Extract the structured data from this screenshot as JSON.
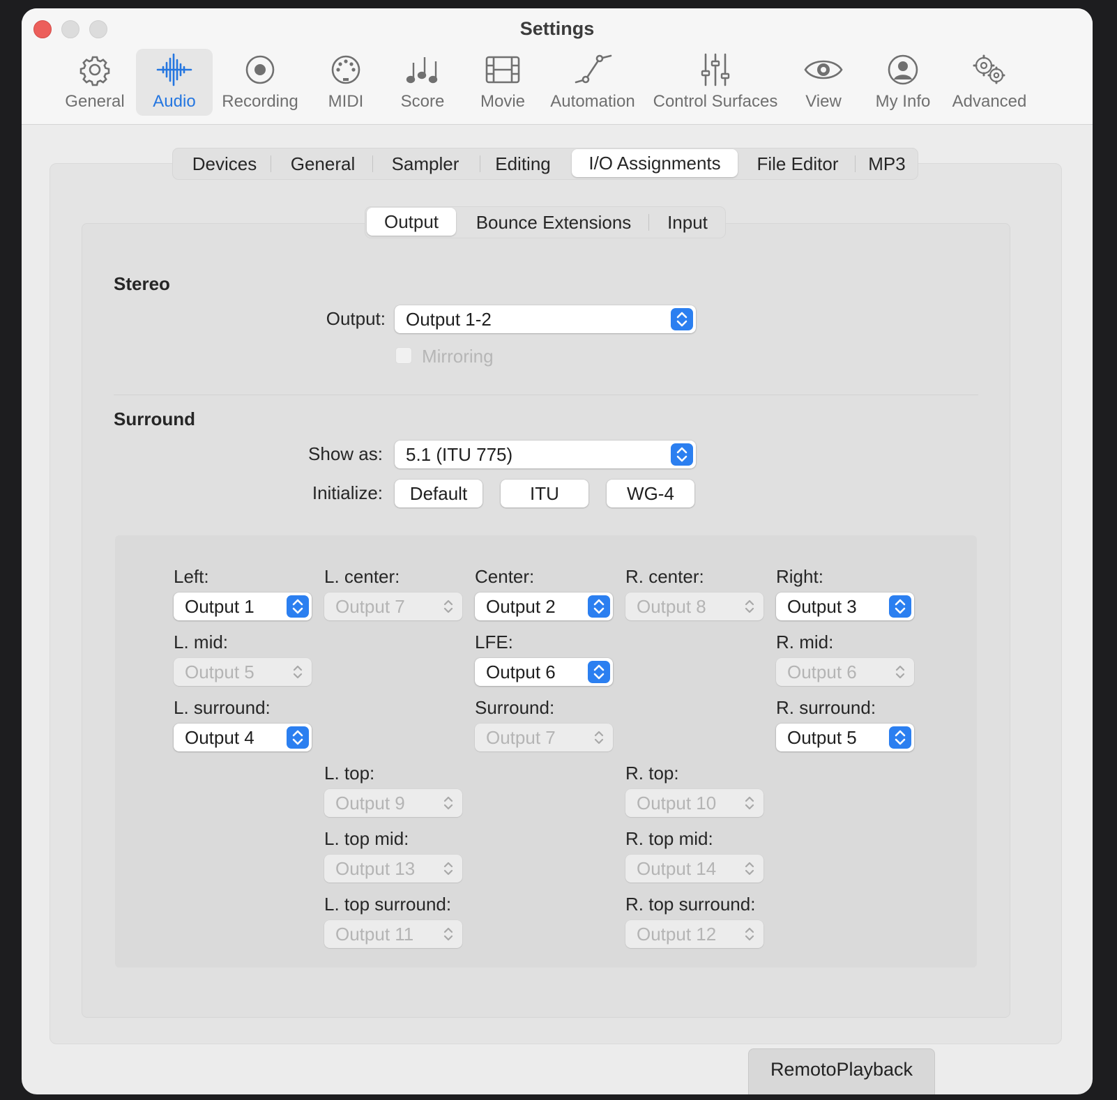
{
  "window": {
    "title": "Settings"
  },
  "toolbar": [
    {
      "label": "General",
      "icon": "gear-icon"
    },
    {
      "label": "Audio",
      "icon": "waveform-icon",
      "selected": true
    },
    {
      "label": "Recording",
      "icon": "record-icon"
    },
    {
      "label": "MIDI",
      "icon": "midi-port-icon"
    },
    {
      "label": "Score",
      "icon": "music-notes-icon"
    },
    {
      "label": "Movie",
      "icon": "film-icon"
    },
    {
      "label": "Automation",
      "icon": "automation-curve-icon"
    },
    {
      "label": "Control Surfaces",
      "icon": "faders-icon"
    },
    {
      "label": "View",
      "icon": "eye-icon"
    },
    {
      "label": "My Info",
      "icon": "person-icon"
    },
    {
      "label": "Advanced",
      "icon": "gears-icon"
    }
  ],
  "audio_tabs": [
    {
      "label": "Devices"
    },
    {
      "label": "General"
    },
    {
      "label": "Sampler"
    },
    {
      "label": "Editing"
    },
    {
      "label": "I/O Assignments",
      "selected": true
    },
    {
      "label": "File Editor"
    },
    {
      "label": "MP3"
    }
  ],
  "io_tabs": [
    {
      "label": "Output",
      "selected": true
    },
    {
      "label": "Bounce Extensions"
    },
    {
      "label": "Input"
    }
  ],
  "stereo": {
    "title": "Stereo",
    "output_label": "Output:",
    "output_value": "Output 1-2",
    "mirroring_label": "Mirroring",
    "mirroring_checked": false
  },
  "surround": {
    "title": "Surround",
    "show_as_label": "Show as:",
    "show_as_value": "5.1 (ITU 775)",
    "initialize_label": "Initialize:",
    "init_buttons": [
      "Default",
      "ITU",
      "WG-4"
    ],
    "channels": {
      "left": {
        "label": "Left:",
        "value": "Output 1",
        "enabled": true
      },
      "l_center": {
        "label": "L. center:",
        "value": "Output 7",
        "enabled": false
      },
      "center": {
        "label": "Center:",
        "value": "Output 2",
        "enabled": true
      },
      "r_center": {
        "label": "R. center:",
        "value": "Output 8",
        "enabled": false
      },
      "right": {
        "label": "Right:",
        "value": "Output 3",
        "enabled": true
      },
      "l_mid": {
        "label": "L. mid:",
        "value": "Output 5",
        "enabled": false
      },
      "lfe": {
        "label": "LFE:",
        "value": "Output 6",
        "enabled": true
      },
      "r_mid": {
        "label": "R. mid:",
        "value": "Output 6",
        "enabled": false
      },
      "l_surround": {
        "label": "L. surround:",
        "value": "Output 4",
        "enabled": true
      },
      "surround": {
        "label": "Surround:",
        "value": "Output 7",
        "enabled": false
      },
      "r_surround": {
        "label": "R. surround:",
        "value": "Output 5",
        "enabled": true
      },
      "l_top": {
        "label": "L. top:",
        "value": "Output 9",
        "enabled": false
      },
      "r_top": {
        "label": "R. top:",
        "value": "Output 10",
        "enabled": false
      },
      "l_top_mid": {
        "label": "L. top mid:",
        "value": "Output 13",
        "enabled": false
      },
      "r_top_mid": {
        "label": "R. top mid:",
        "value": "Output 14",
        "enabled": false
      },
      "l_top_surround": {
        "label": "L. top surround:",
        "value": "Output 11",
        "enabled": false
      },
      "r_top_surround": {
        "label": "R. top surround:",
        "value": "Output 12",
        "enabled": false
      }
    }
  },
  "background_window": {
    "tab_label": "RemotoPlayback"
  },
  "colors": {
    "accent": "#2476e0",
    "close": "#ec5f5b",
    "popup_arrow": "#2b7ff0"
  }
}
